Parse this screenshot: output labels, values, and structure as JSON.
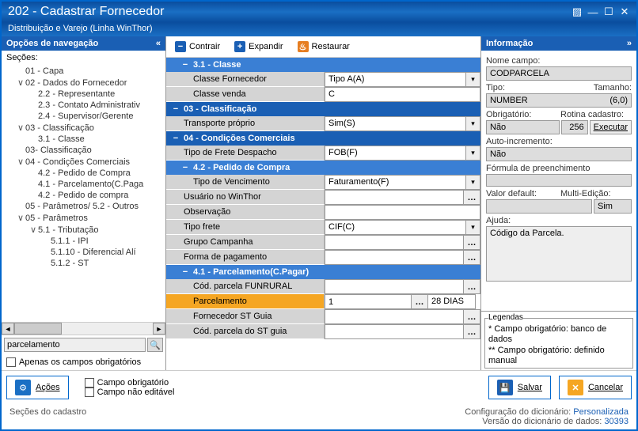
{
  "window": {
    "title": "202 - Cadastrar  Fornecedor",
    "subtitle": "Distribuição e Varejo (Linha WinThor)"
  },
  "nav_header": "Opções de navegação",
  "sections_label": "Seções:",
  "tree": [
    {
      "d": 1,
      "t": "",
      "l": "01 - Capa"
    },
    {
      "d": 1,
      "t": "∨",
      "l": "02 - Dados do Fornecedor"
    },
    {
      "d": 2,
      "t": "",
      "l": "2.2 - Representante"
    },
    {
      "d": 2,
      "t": "",
      "l": "2.3 - Contato Administrativ"
    },
    {
      "d": 2,
      "t": "",
      "l": "2.4 - Supervisor/Gerente"
    },
    {
      "d": 1,
      "t": "∨",
      "l": "03 - Classificação"
    },
    {
      "d": 2,
      "t": "",
      "l": "3.1 - Classe"
    },
    {
      "d": 1,
      "t": "",
      "l": "03- Classificação"
    },
    {
      "d": 1,
      "t": "∨",
      "l": "04 - Condições Comerciais"
    },
    {
      "d": 2,
      "t": "",
      "l": "4.2 - Pedido de Compra"
    },
    {
      "d": 2,
      "t": "",
      "l": "4.1 - Parcelamento(C.Paga"
    },
    {
      "d": 2,
      "t": "",
      "l": "4.2 - Pedido de compra"
    },
    {
      "d": 1,
      "t": "",
      "l": "05 - Parâmetros/ 5.2 - Outros"
    },
    {
      "d": 1,
      "t": "∨",
      "l": "05 - Parâmetros"
    },
    {
      "d": 2,
      "t": "∨",
      "l": "5.1 - Tributação"
    },
    {
      "d": 3,
      "t": "",
      "l": "5.1.1 - IPI"
    },
    {
      "d": 3,
      "t": "",
      "l": "5.1.10 - Diferencial Alí"
    },
    {
      "d": 3,
      "t": "",
      "l": "5.1.2 - ST"
    }
  ],
  "search_value": "parcelamento",
  "chk_obrig": "Apenas os campos obrigatórios",
  "toolbar": {
    "contrair": "Contrair",
    "expandir": "Expandir",
    "restaurar": "Restaurar"
  },
  "groups": {
    "g31": "3.1 - Classe",
    "g03": "03 - Classificação",
    "g04": "04 - Condições Comerciais",
    "g42": "4.2 - Pedido de Compra",
    "g41": "4.1 - Parcelamento(C.Pagar)"
  },
  "rows": {
    "classe_fornecedor": {
      "label": "Classe Fornecedor",
      "val": "Tipo A(A)"
    },
    "classe_venda": {
      "label": "Classe venda",
      "val": "C"
    },
    "transporte_proprio": {
      "label": "Transporte próprio",
      "val": "Sim(S)"
    },
    "tipo_frete_desp": {
      "label": "Tipo de Frete Despacho",
      "val": "FOB(F)"
    },
    "tipo_venc": {
      "label": "Tipo de Vencimento",
      "val": "Faturamento(F)"
    },
    "usuario": {
      "label": "Usuário no WinThor",
      "val": ""
    },
    "obs": {
      "label": "Observação",
      "val": ""
    },
    "tipo_frete": {
      "label": "Tipo frete",
      "val": "CIF(C)"
    },
    "grupo_camp": {
      "label": "Grupo Campanha",
      "val": ""
    },
    "forma_pag": {
      "label": "Forma de pagamento",
      "val": ""
    },
    "cod_funrural": {
      "label": "Cód. parcela FUNRURAL",
      "val": ""
    },
    "parcelamento": {
      "label": "Parcelamento",
      "val": "1",
      "extra": "28 DIAS"
    },
    "fornec_st": {
      "label": "Fornecedor ST Guia",
      "val": ""
    },
    "cod_st_guia": {
      "label": "Cód. parcela do ST guia",
      "val": ""
    }
  },
  "info": {
    "header": "Informação",
    "nome_campo_lbl": "Nome campo:",
    "nome_campo": "CODPARCELA",
    "tipo_lbl": "Tipo:",
    "tamanho_lbl": "Tamanho:",
    "tipo": "NUMBER",
    "tamanho": "(6,0)",
    "obrig_lbl": "Obrigatório:",
    "rotina_lbl": "Rotina cadastro:",
    "obrig": "Não",
    "rotina": "256",
    "executar": "Executar",
    "autoinc_lbl": "Auto-incremento:",
    "autoinc": "Não",
    "formula_lbl": "Fórmula de preenchimento",
    "formula": "",
    "valdef_lbl": "Valor default:",
    "multi_lbl": "Multi-Edição:",
    "valdef": "",
    "multi": "Sim",
    "ajuda_lbl": "Ajuda:",
    "ajuda": "Código da Parcela."
  },
  "legend": {
    "title": "Legendas",
    "l1": "* Campo obrigatório: banco de dados",
    "l2": "** Campo obrigatório: definido manual"
  },
  "bottom": {
    "acoes": "Ações",
    "campo_obrig": "Campo obrigatório",
    "campo_nao_edit": "Campo não editável",
    "salvar": "Salvar",
    "cancelar": "Cancelar"
  },
  "status": {
    "left": "Seções do cadastro",
    "r1_lbl": "Configuração do dicionário: ",
    "r1_val": "Personalizada",
    "r2_lbl": "Versão do dicionário de dados: ",
    "r2_val": "30393"
  }
}
